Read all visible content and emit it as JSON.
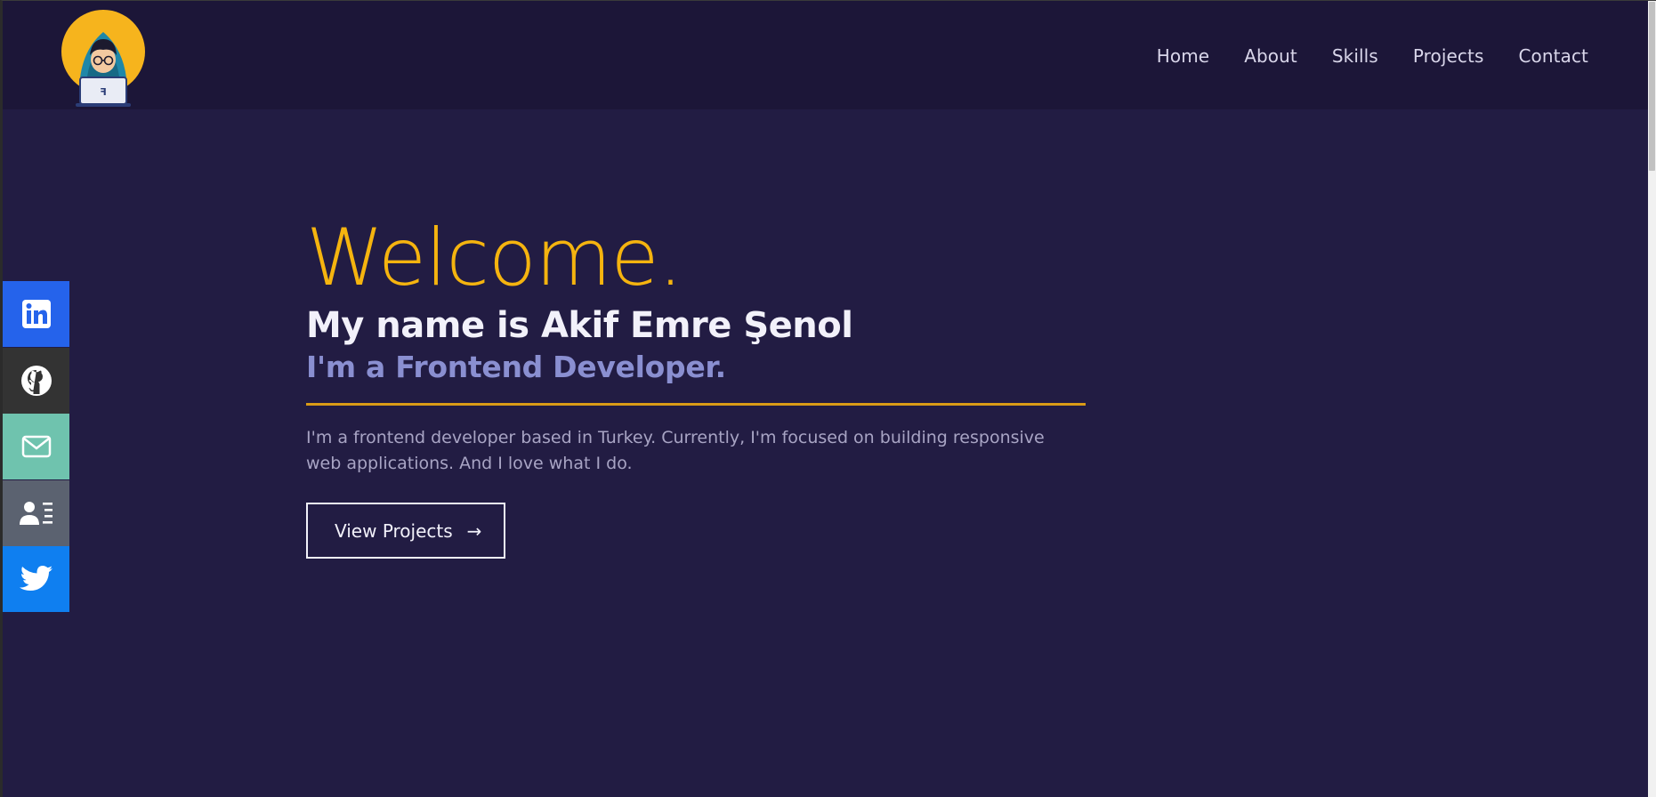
{
  "nav": {
    "links": [
      "Home",
      "About",
      "Skills",
      "Projects",
      "Contact"
    ]
  },
  "social": [
    {
      "name": "linkedin-icon",
      "color": "#2563eb"
    },
    {
      "name": "github-icon",
      "color": "#333333"
    },
    {
      "name": "mail-icon",
      "color": "#6fc3ae"
    },
    {
      "name": "contact-card-icon",
      "color": "#5b6270"
    },
    {
      "name": "twitter-icon",
      "color": "#0f7ff0"
    }
  ],
  "hero": {
    "welcome": "Welcome.",
    "name": "My name is Akif Emre Şenol",
    "role": "I'm a Frontend Developer.",
    "description": "I'm a frontend developer based in Turkey. Currently, I'm focused on building responsive web applications. And I love what I do.",
    "button_label": "View Projects",
    "button_arrow": "→"
  },
  "colors": {
    "background": "#221c43",
    "navbar": "#1c1638",
    "accent": "#f5b40f",
    "role": "#8a8fd1"
  }
}
